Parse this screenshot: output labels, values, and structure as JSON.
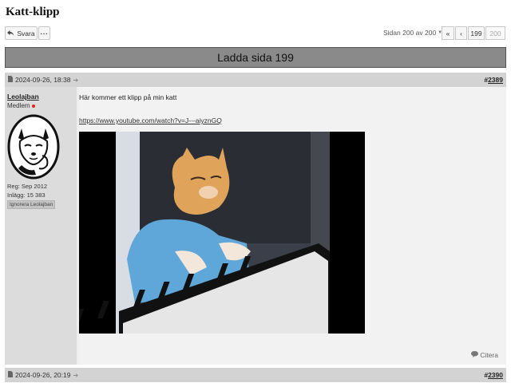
{
  "page": {
    "title": "Katt-klipp"
  },
  "toolbar": {
    "reply_label": "Svara",
    "more_label": "···"
  },
  "pagination": {
    "info": "Sidan 200 av 200",
    "first_label": "«",
    "prev_label": "‹",
    "page_prev": "199",
    "page_current": "200"
  },
  "load_bar": {
    "label": "Ladda sida 199"
  },
  "post": {
    "date": "2024-09-26, 18:38",
    "number": "2389",
    "author": {
      "name": "Leolajban",
      "role": "Medlem",
      "reg": "Reg: Sep 2012",
      "posts": "Inlägg: 15 383",
      "ignore_label": "Ignorera Leolajban"
    },
    "text": "Här kommer ett klipp på min katt",
    "link": "https://www.youtube.com/watch?v=J---aiyznGQ",
    "cite_label": "Citera"
  },
  "next_post": {
    "date": "2024-09-26, 20:19",
    "number": "2390"
  },
  "icons": {
    "reply": "reply-arrow-icon",
    "document": "document-icon",
    "permalink": "arrow-right-icon",
    "quote": "speech-bubble-icon",
    "online": "online-dot-icon"
  },
  "colors": {
    "load_bar": "#8a8a8a",
    "post_header": "#d3d3d3",
    "user_column": "#dcdcdc",
    "online_dot": "#dd2222"
  }
}
